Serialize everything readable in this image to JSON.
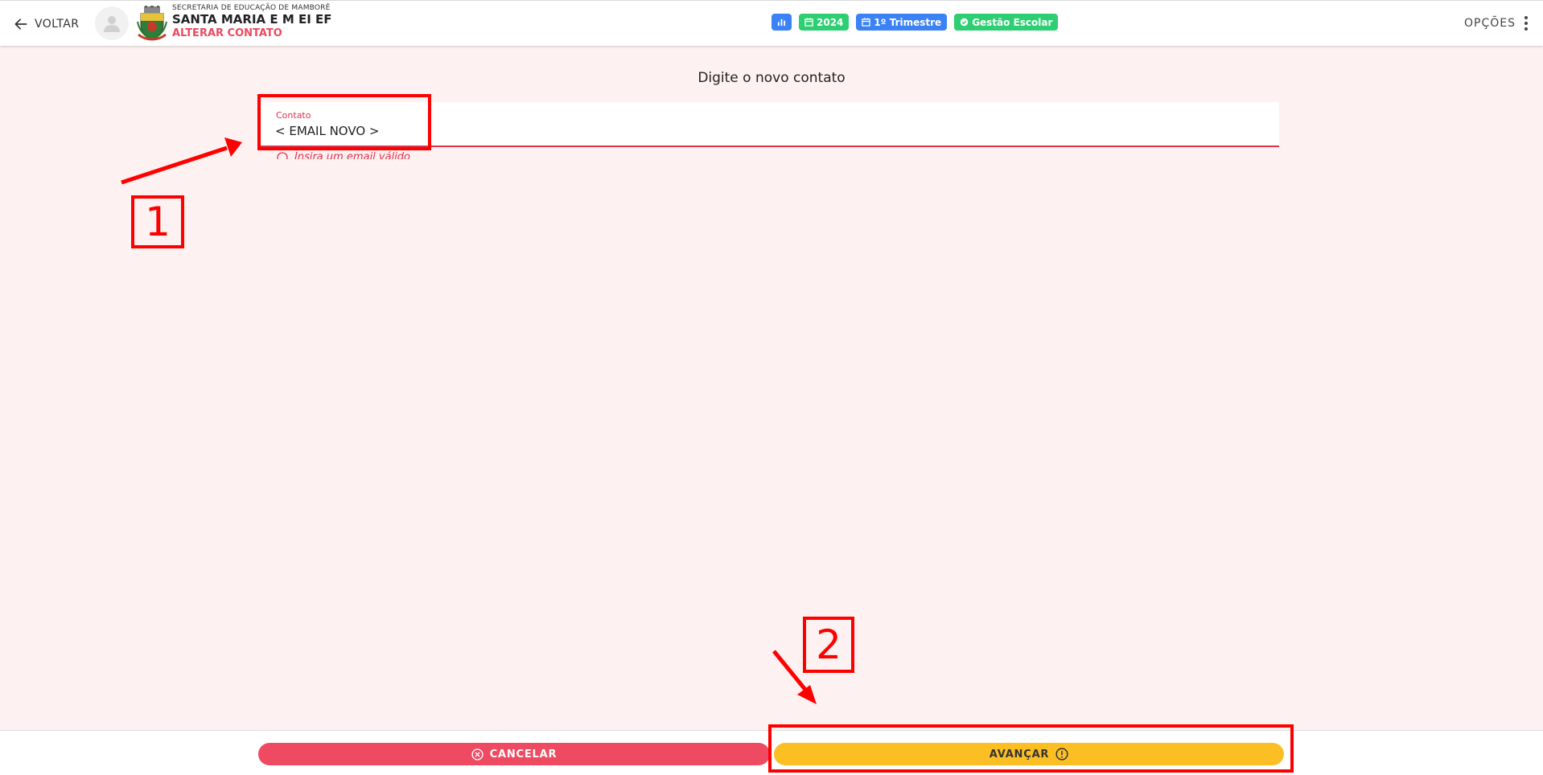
{
  "header": {
    "back_label": "VOLTAR",
    "secretaria": "SECRETARIA DE EDUCAÇÃO DE MAMBORÊ",
    "school_name": "SANTA MARIA E M EI EF",
    "page_title": "ALTERAR CONTATO",
    "badges": [
      {
        "icon": "bar-chart-icon",
        "label": "",
        "color": "#3b82f6"
      },
      {
        "icon": "calendar-icon",
        "label": "2024",
        "color": "#2ecf73"
      },
      {
        "icon": "calendar-icon",
        "label": "1º Trimestre",
        "color": "#3b82f6"
      },
      {
        "icon": "check-circle-icon",
        "label": "Gestão Escolar",
        "color": "#2ecf73"
      }
    ],
    "options_label": "OPÇÕES"
  },
  "main": {
    "title": "Digite o novo contato",
    "field": {
      "label": "Contato",
      "value": "< EMAIL NOVO >",
      "error": "Insira um email válido"
    }
  },
  "annotations": {
    "step1": "1",
    "step2": "2",
    "color": "#ff0000"
  },
  "footer": {
    "cancel_label": "CANCELAR",
    "next_label": "AVANÇAR"
  },
  "colors": {
    "accent_red": "#ee4960",
    "cancel_button": "#ee4a62",
    "next_button": "#fbbf24",
    "background": "#fdf1f1"
  }
}
